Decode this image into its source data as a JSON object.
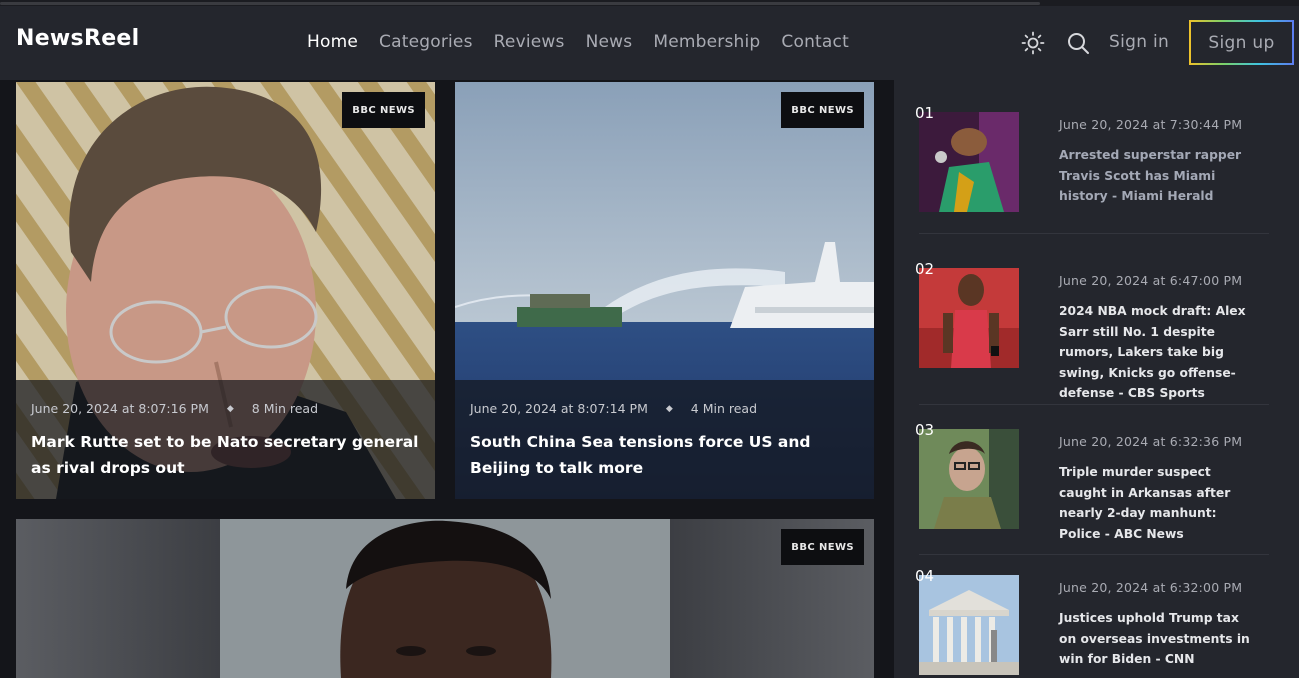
{
  "header": {
    "logo": "NewsReel",
    "nav": [
      "Home",
      "Categories",
      "Reviews",
      "News",
      "Membership",
      "Contact"
    ],
    "active_nav": "Home",
    "sign_in": "Sign in",
    "sign_up": "Sign up",
    "icons": [
      "sun-icon",
      "search-icon"
    ]
  },
  "featured": [
    {
      "badge": "BBC NEWS",
      "date": "June 20, 2024 at 8:07:16 PM",
      "read_time": "8 Min read",
      "title": "Mark Rutte set to be Nato secretary general as rival drops out"
    },
    {
      "badge": "BBC NEWS",
      "date": "June 20, 2024 at 8:07:14 PM",
      "read_time": "4 Min read",
      "title": "South China Sea tensions force US and Beijing to talk more"
    },
    {
      "badge": "BBC NEWS"
    }
  ],
  "sidebar": [
    {
      "num": "01",
      "date": "June 20, 2024 at 7:30:44 PM",
      "title": "Arrested superstar rapper Travis Scott has Miami history - Miami Herald"
    },
    {
      "num": "02",
      "date": "June 20, 2024 at 6:47:00 PM",
      "title": "2024 NBA mock draft: Alex Sarr still No. 1 despite rumors, Lakers take big swing, Knicks go offense-defense - CBS Sports"
    },
    {
      "num": "03",
      "date": "June 20, 2024 at 6:32:36 PM",
      "title": "Triple murder suspect caught in Arkansas after nearly 2-day manhunt: Police - ABC News"
    },
    {
      "num": "04",
      "date": "June 20, 2024 at 6:32:00 PM",
      "title": "Justices uphold Trump tax on overseas investments in win for Biden - CNN"
    }
  ]
}
